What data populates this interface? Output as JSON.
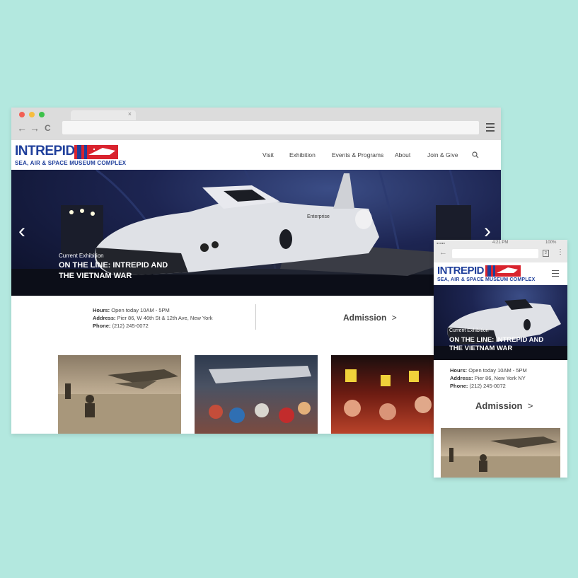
{
  "desktop": {
    "tab_close": "×",
    "nav_back": "←",
    "nav_forward": "→",
    "nav_reload": "C",
    "logo": {
      "word": "INTREPID",
      "sub": "SEA, AIR & SPACE MUSEUM COMPLEX"
    },
    "nav": [
      "Visit",
      "Exhibition",
      "Events & Programs",
      "About",
      "Join & Give"
    ],
    "hero": {
      "kicker": "Current Exhibition",
      "title_line1": "ON THE LINE: INTREPID AND",
      "title_line2": "THE VIETNAM WAR",
      "prev": "‹",
      "next": "›",
      "shuttle_label": "Enterprise"
    },
    "info": {
      "hours_label": "Hours:",
      "hours": "Open today 10AM - 5PM",
      "address_label": "Address:",
      "address": "Pier 86, W 46th St & 12th Ave, New York",
      "phone_label": "Phone:",
      "phone": "(212) 245-0072"
    },
    "admission": "Admission",
    "admission_arrow": ">"
  },
  "mobile": {
    "status": {
      "carrier": "●●●●●",
      "time": "4:21 PM",
      "battery": "100%"
    },
    "back": "←",
    "tabs_count": "2",
    "menu_dots": "⋮",
    "logo": {
      "word": "INTREPID",
      "sub": "SEA, AIR & SPACE MUSEUM COMPLEX"
    },
    "hero": {
      "kicker": "Current Exhibition",
      "title_line1": "ON THE LINE: INTREPID AND",
      "title_line2": "THE VIETNAM WAR"
    },
    "info": {
      "hours_label": "Hours:",
      "hours": "Open today 10AM - 5PM",
      "address_label": "Address:",
      "address": "Pier 86, New York NY",
      "phone_label": "Phone:",
      "phone": "(212) 245-0072"
    },
    "admission": "Admission",
    "admission_arrow": ">"
  },
  "colors": {
    "background": "#b3e8df",
    "brand_blue": "#1f3f9b",
    "brand_red": "#d9232e"
  }
}
